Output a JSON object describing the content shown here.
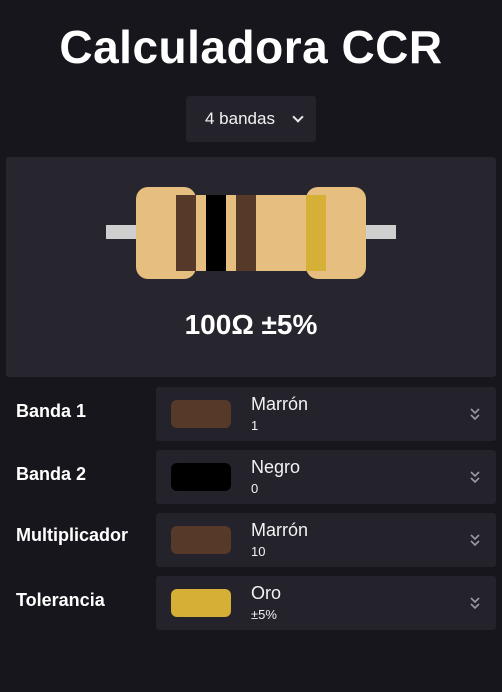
{
  "title": "Calculadora CCR",
  "band_count": {
    "selected": "4 bandas"
  },
  "result": {
    "text": "100Ω ±5%"
  },
  "resistor": {
    "body_color": "#e5be80",
    "lead_color": "#cfcfcf",
    "bands": [
      "#57392a",
      "#000000",
      "#57392a",
      "#d6af36"
    ]
  },
  "rows": [
    {
      "label": "Banda 1",
      "color_name": "Marrón",
      "color_value": "1",
      "swatch": "#57392a"
    },
    {
      "label": "Banda 2",
      "color_name": "Negro",
      "color_value": "0",
      "swatch": "#000000"
    },
    {
      "label": "Multiplicador",
      "color_name": "Marrón",
      "color_value": "10",
      "swatch": "#57392a"
    },
    {
      "label": "Tolerancia",
      "color_name": "Oro",
      "color_value": "±5%",
      "swatch": "#d6af36"
    }
  ]
}
